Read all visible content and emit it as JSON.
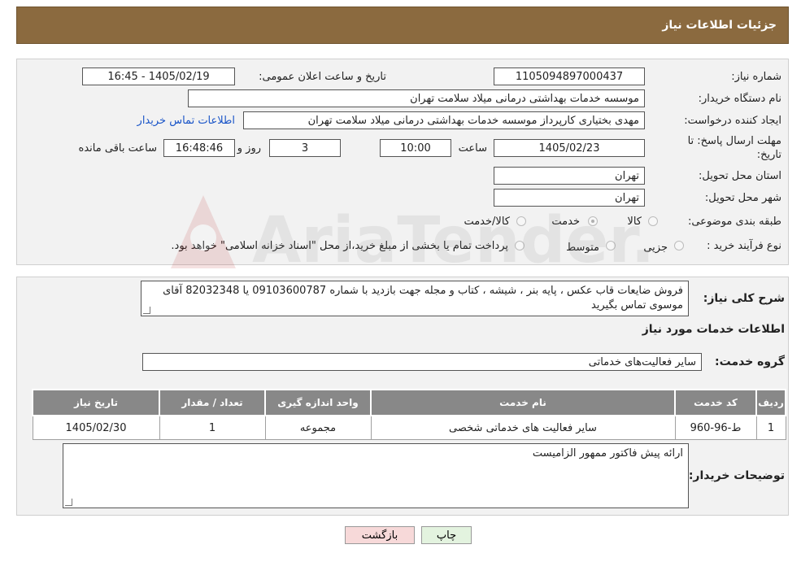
{
  "header": {
    "title": "جزئیات اطلاعات نیاز"
  },
  "form": {
    "need_number_label": "شماره نیاز:",
    "need_number": "1105094897000437",
    "announce_label": "تاریخ و ساعت اعلان عمومی:",
    "announce_value": "1405/02/19 - 16:45",
    "buyer_org_label": "نام دستگاه خریدار:",
    "buyer_org": "موسسه خدمات بهداشتی درمانی میلاد سلامت تهران",
    "creator_label": "ایجاد کننده درخواست:",
    "creator": "مهدی بختیاری کارپرداز موسسه خدمات بهداشتی درمانی میلاد سلامت تهران",
    "contact_link": "اطلاعات تماس خریدار",
    "deadline_label_1": "مهلت ارسال پاسخ: تا",
    "deadline_label_2": "تاریخ:",
    "deadline_date": "1405/02/23",
    "time_label": "ساعت",
    "deadline_time": "10:00",
    "days": "3",
    "days_label": "روز و",
    "remaining_time": "16:48:46",
    "remaining_label": "ساعت باقی مانده",
    "province_label": "استان محل تحویل:",
    "province": "تهران",
    "city_label": "شهر محل تحویل:",
    "city": "تهران",
    "category_label": "طبقه بندی موضوعی:",
    "category_options": [
      "کالا",
      "خدمت",
      "کالا/خدمت"
    ],
    "category_selected": "خدمت",
    "purchase_type_label": "نوع فرآیند خرید :",
    "purchase_options": [
      "جزیی",
      "متوسط"
    ],
    "purchase_note": "پرداخت تمام یا بخشی از مبلغ خرید،از محل \"اسناد خزانه اسلامی\" خواهد بود."
  },
  "details": {
    "summary_label": "شرح کلی نیاز:",
    "summary_text": "فروش ضایعات قاب عکس ، پایه بنر ، شیشه ، کتاب و مجله جهت بازدید با شماره 09103600787 یا 82032348 آقای موسوی تماس بگیرید",
    "services_title": "اطلاعات خدمات مورد نیاز",
    "service_group_label": "گروه خدمت:",
    "service_group": "سایر فعالیت‌های خدماتی",
    "table": {
      "headers": [
        "ردیف",
        "کد خدمت",
        "نام خدمت",
        "واحد اندازه گیری",
        "تعداد / مقدار",
        "تاریخ نیاز"
      ],
      "rows": [
        [
          "1",
          "ط-96-960",
          "سایر فعالیت های خدماتی شخصی",
          "مجموعه",
          "1",
          "1405/02/30"
        ]
      ]
    },
    "notes_label": "توضیحات خریدار:",
    "notes_text": "ارائه پیش فاکتور ممهور الزامیست"
  },
  "buttons": {
    "print": "چاپ",
    "back": "بازگشت"
  },
  "watermark": {
    "text": "AriaTender.neT"
  },
  "colors": {
    "header_bg": "#8b6a3f",
    "link": "#1a55c8",
    "back_button_bg": "#f7d9d9",
    "print_button_bg": "#e3f3df"
  }
}
